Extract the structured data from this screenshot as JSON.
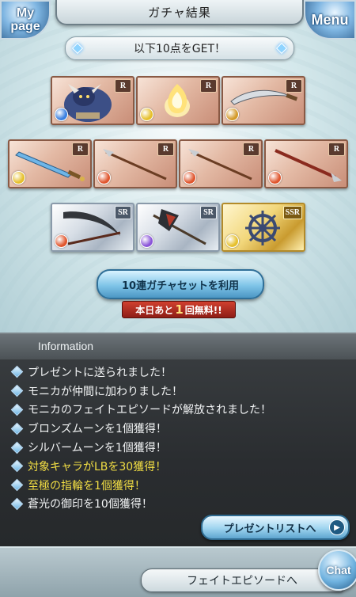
{
  "header": {
    "title": "ガチャ結果",
    "mypage_label": "My page",
    "menu_label": "Menu"
  },
  "banner": {
    "text": "以下10点をGET！"
  },
  "items": [
    {
      "rarity": "R",
      "element": "water",
      "element_color": "#3a7fe0",
      "art": "monster"
    },
    {
      "rarity": "R",
      "element": "light",
      "element_color": "#e6c02d",
      "art": "flame-spirit"
    },
    {
      "rarity": "R",
      "element": "earth",
      "element_color": "#d49a2a",
      "art": "scimitar"
    },
    {
      "rarity": "R",
      "element": "light",
      "element_color": "#e6c02d",
      "art": "sword"
    },
    {
      "rarity": "R",
      "element": "fire",
      "element_color": "#e0562e",
      "art": "spear"
    },
    {
      "rarity": "R",
      "element": "fire",
      "element_color": "#e0562e",
      "art": "spear"
    },
    {
      "rarity": "R",
      "element": "fire",
      "element_color": "#e0562e",
      "art": "spear"
    },
    {
      "rarity": "SR",
      "element": "fire",
      "element_color": "#e0562e",
      "art": "scythe"
    },
    {
      "rarity": "SR",
      "element": "dark",
      "element_color": "#8a55d8",
      "art": "axe"
    },
    {
      "rarity": "SSR",
      "element": "light",
      "element_color": "#e6c02d",
      "art": "helm-wheel"
    }
  ],
  "gacha": {
    "button_label": "10連ガチャセットを利用",
    "free_prefix": "本日あと",
    "free_count": "1",
    "free_suffix": "回無料!!"
  },
  "information": {
    "header": "Information",
    "messages": [
      {
        "text": "プレゼントに送られました！",
        "highlight": false
      },
      {
        "text": "モニカが仲間に加わりました！",
        "highlight": false
      },
      {
        "text": "モニカのフェイトエピソードが解放されました！",
        "highlight": false
      },
      {
        "text": "ブロンズムーンを1個獲得！",
        "highlight": false
      },
      {
        "text": "シルバームーンを1個獲得！",
        "highlight": false
      },
      {
        "text": "対象キャラがLBを30獲得！",
        "highlight": true
      },
      {
        "text": "至極の指輪を1個獲得！",
        "highlight": true
      },
      {
        "text": "蒼光の御印を10個獲得！",
        "highlight": false
      }
    ],
    "present_button": "プレゼントリストへ"
  },
  "footer": {
    "fate_button": "フェイトエピソードへ",
    "chat_label": "Chat"
  },
  "colors": {
    "highlight_text": "#f3df44",
    "panel_bg": "#2a2d30",
    "accent_blue": "#7fc4e8"
  }
}
